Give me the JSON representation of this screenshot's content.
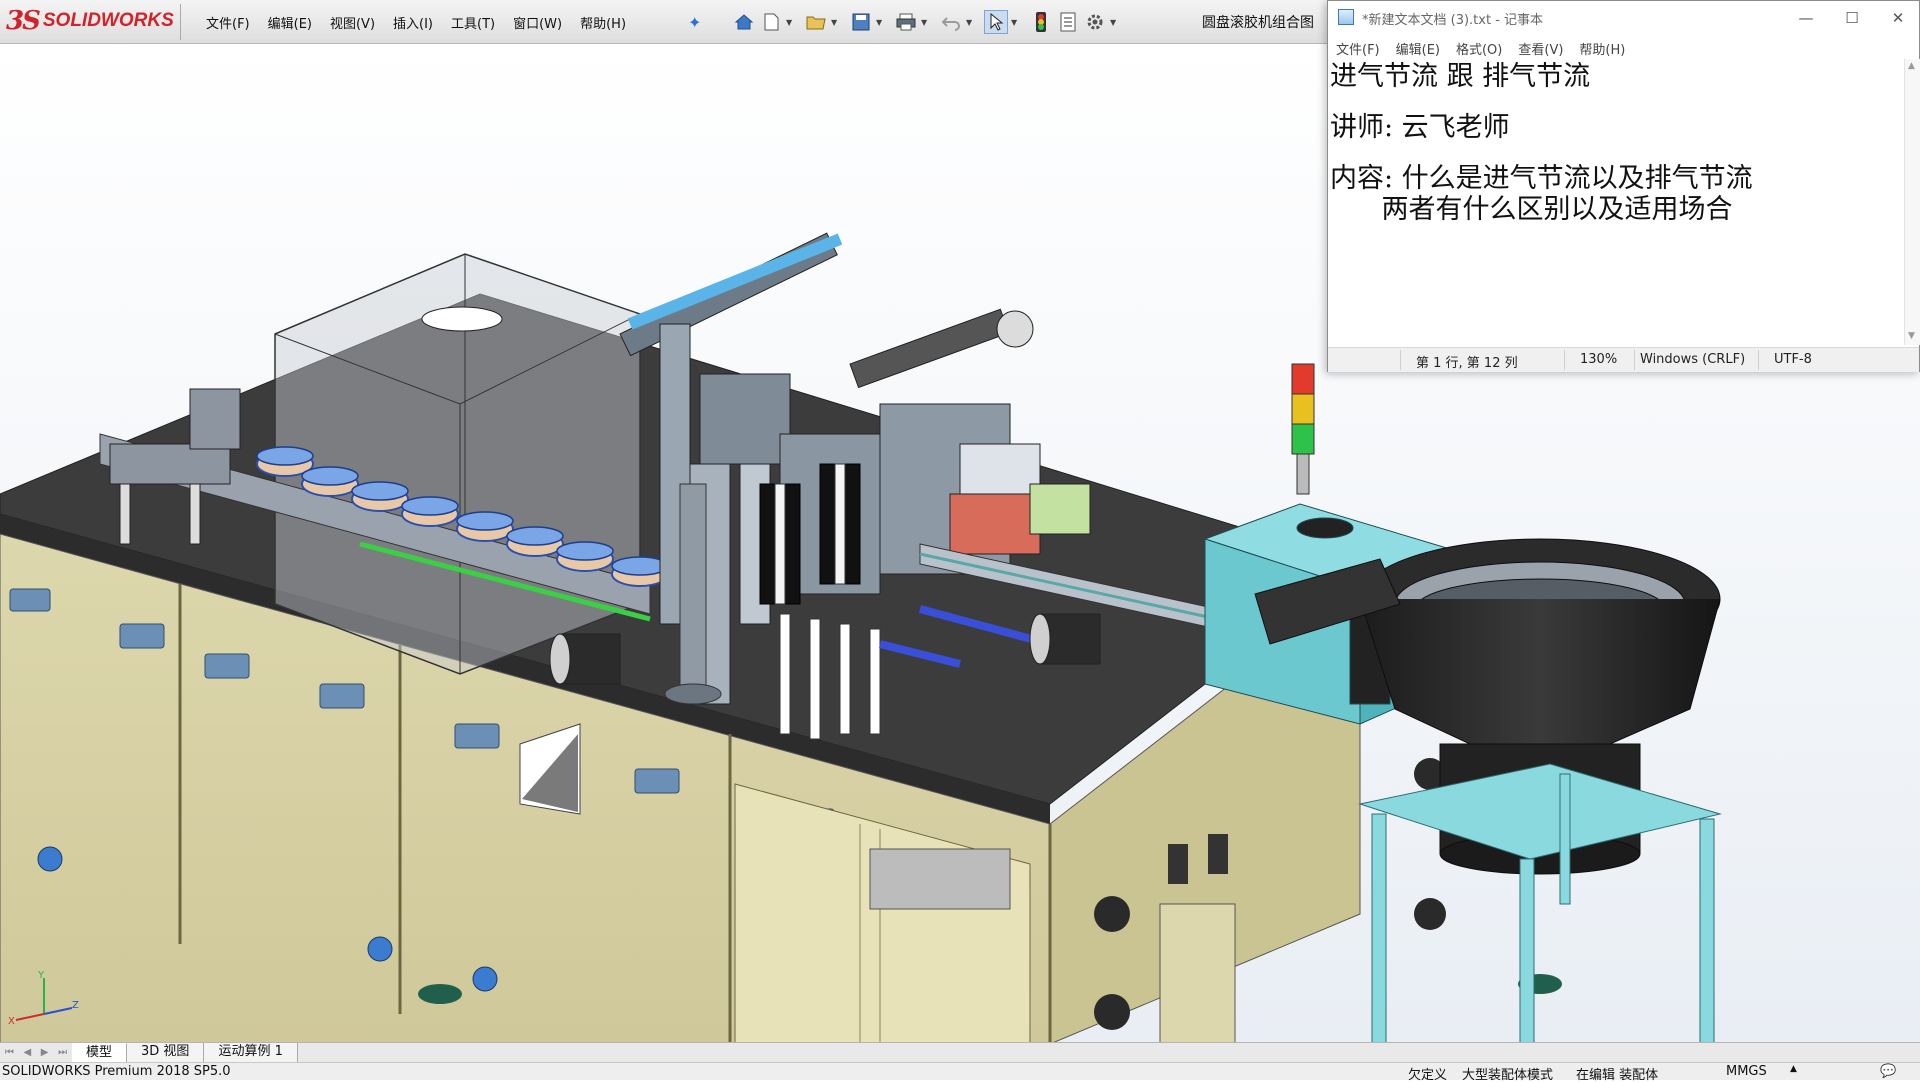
{
  "solidworks": {
    "logo_ds": "3S",
    "logo_text": "SOLIDWORKS",
    "menu": [
      "文件(F)",
      "编辑(E)",
      "视图(V)",
      "插入(I)",
      "工具(T)",
      "窗口(W)",
      "帮助(H)"
    ],
    "document_title": "圆盘滚胶机组合图",
    "bottom_tabs": [
      "模型",
      "3D 视图",
      "运动算例 1"
    ],
    "active_tab": 0,
    "status_left": "SOLIDWORKS Premium 2018 SP5.0",
    "status_right": [
      "欠定义",
      "大型装配体模式",
      "在编辑 装配体",
      "MMGS"
    ],
    "triad_labels": {
      "x": "X",
      "y": "Y",
      "z": "Z"
    },
    "colors": {
      "accent": "#d2232a",
      "workbench_top": "#3f3f3f",
      "cabinet": "#d6d0a4",
      "feeder_bowl": "#2b2b2b",
      "stand": "#7fd6dd"
    }
  },
  "notepad": {
    "title": "*新建文本文档 (3).txt - 记事本",
    "menu": [
      "文件(F)",
      "编辑(E)",
      "格式(O)",
      "查看(V)",
      "帮助(H)"
    ],
    "lines": [
      "进气节流 跟 排气节流",
      "",
      "讲师: 云飞老师",
      "",
      "内容: 什么是进气节流以及排气节流",
      "      两者有什么区别以及适用场合"
    ],
    "status": {
      "position": "第 1 行, 第 12 列",
      "zoom": "130%",
      "line_ending": "Windows (CRLF)",
      "encoding": "UTF-8"
    },
    "window_controls": {
      "minimize": "—",
      "maximize": "☐",
      "close": "✕"
    }
  }
}
